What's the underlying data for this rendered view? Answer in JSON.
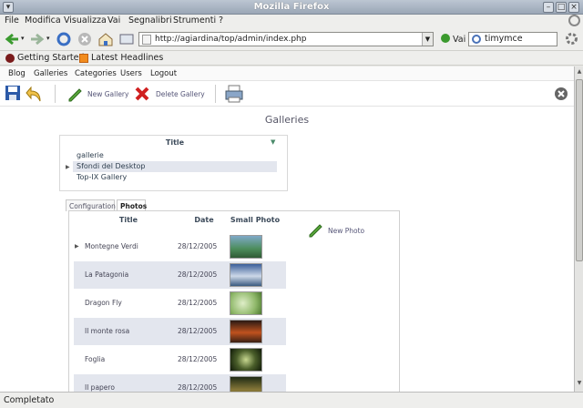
{
  "window": {
    "title": "Mozilla Firefox"
  },
  "menu": [
    "File",
    "Modifica",
    "Visualizza",
    "Vai",
    "Segnalibri",
    "Strumenti",
    "?"
  ],
  "nav": {
    "url": "http://agiardina/top/admin/index.php",
    "go_label": "Vai",
    "search_value": "timymce"
  },
  "bookmarks": [
    "Getting Started",
    "Latest Headlines"
  ],
  "app_menu": [
    "Blog",
    "Galleries",
    "Categories",
    "Users",
    "Logout"
  ],
  "app_toolbar": {
    "new_gallery": "New Gallery",
    "delete_gallery": "Delete Gallery"
  },
  "page_title": "Galleries",
  "galleries": {
    "header": "Title",
    "rows": [
      "gallerie",
      "Sfondi del Desktop",
      "Top-IX Gallery"
    ],
    "selected": 1
  },
  "tabs": [
    "Configuration",
    "Photos"
  ],
  "photos": {
    "headers": [
      "Title",
      "Date",
      "Small Photo"
    ],
    "rows": [
      {
        "title": "Montegne Verdi",
        "date": "28/12/2005",
        "color": "#4b8c5a"
      },
      {
        "title": "La Patagonia",
        "date": "28/12/2005",
        "color": "#5f7ea8"
      },
      {
        "title": "Dragon Fly",
        "date": "28/12/2005",
        "color": "#9fc07c"
      },
      {
        "title": "Il monte rosa",
        "date": "28/12/2005",
        "color": "#b5491f"
      },
      {
        "title": "Foglia",
        "date": "28/12/2005",
        "color": "#3e4f2a"
      },
      {
        "title": "Il papero",
        "date": "28/12/2005",
        "color": "#8a7a3a"
      }
    ],
    "new_photo": "New Photo"
  },
  "status": "Completato"
}
